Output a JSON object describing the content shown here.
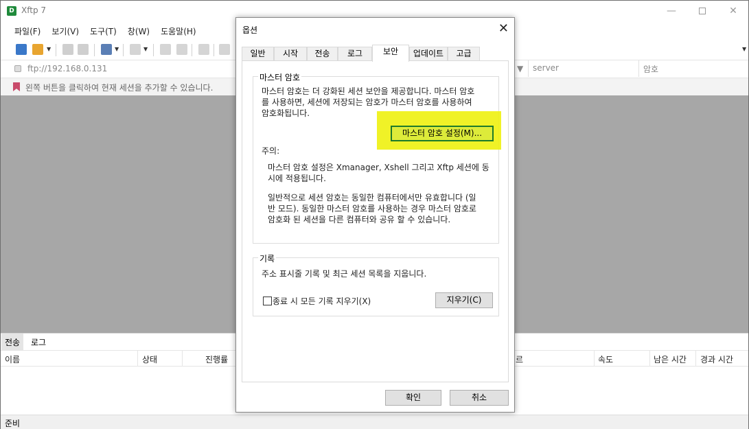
{
  "app": {
    "title": "Xftp 7",
    "icon_letter": "D"
  },
  "menu": [
    "파일(F)",
    "보기(V)",
    "도구(T)",
    "창(W)",
    "도움말(H)"
  ],
  "address": {
    "url": "ftp://192.168.0.131",
    "col_server": "server",
    "col_password": "암호"
  },
  "hint": "왼쪽 버튼을 클릭하여 현재 세션을 추가할 수 있습니다.",
  "bottom_tabs": [
    "전송",
    "로그"
  ],
  "transfer_columns": {
    "name": "이름",
    "status": "상태",
    "progress": "진행률",
    "r": "르",
    "speed": "속도",
    "remaining": "남은 시간",
    "elapsed": "경과 시간"
  },
  "status": "준비",
  "dialog": {
    "title": "옵션",
    "tabs": [
      "일반",
      "시작",
      "전송",
      "로그",
      "보안",
      "업데이트",
      "고급"
    ],
    "active_tab": "보안",
    "master_group": {
      "title": "마스터 암호",
      "desc_line1": "마스터 암호는 더 강화된 세션 보안을 제공합니다. 마스터 암호",
      "desc_line2": "를 사용하면, 세션에 저장되는 암호가 마스터 암호를 사용하여",
      "desc_line3": "암호화됩니다.",
      "button": "마스터 암호 설정(M)...",
      "note_title": "주의:",
      "note1_line1": "마스터 암호 설정은 Xmanager, Xshell 그리고 Xftp 세션에 동",
      "note1_line2": "시에 적용됩니다.",
      "note2_line1": "일반적으로 세션 암호는 동일한 컴퓨터에서만 유효합니다 (일",
      "note2_line2": "반 모드). 동일한 마스터 암호를 사용하는 경우 마스터 암호로",
      "note2_line3": "암호화 된 세션을 다른 컴퓨터와 공유 할 수 있습니다."
    },
    "history_group": {
      "title": "기록",
      "desc": "주소 표시줄 기록 및 최근 세션 목록을 지웁니다.",
      "checkbox_label": "종료 시 모든 기록 지우기(X)",
      "clear_button": "지우기(C)"
    },
    "ok": "확인",
    "cancel": "취소"
  },
  "colors": {
    "highlight": "#eef10f",
    "master_button_border": "#1d7a2a",
    "session_background": "#a7a7a7"
  }
}
